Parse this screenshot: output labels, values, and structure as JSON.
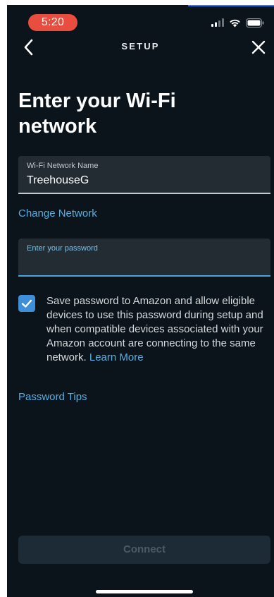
{
  "status_bar": {
    "time": "5:20",
    "icons": [
      "cellular-signal-icon",
      "wifi-icon",
      "battery-icon"
    ]
  },
  "nav": {
    "back_icon": "chevron-left-icon",
    "title": "SETUP",
    "close_icon": "close-icon"
  },
  "heading": "Enter your Wi-Fi network",
  "network_field": {
    "label": "Wi-Fi Network Name",
    "value": "TreehouseG"
  },
  "change_network": "Change Network",
  "password_field": {
    "label": "Enter your password",
    "value": ""
  },
  "save_password": {
    "checked": true,
    "text": "Save password to Amazon and allow eligible devices to use this password during setup and when compatible devices associated with your Amazon account are connecting to the same network.",
    "learn_more": "Learn More"
  },
  "password_tips": "Password Tips",
  "connect_button": "Connect",
  "colors": {
    "background": "#0b141b",
    "link": "#58aee2",
    "checkbox": "#3e8fd8",
    "time_pill": "#e94d3f"
  }
}
